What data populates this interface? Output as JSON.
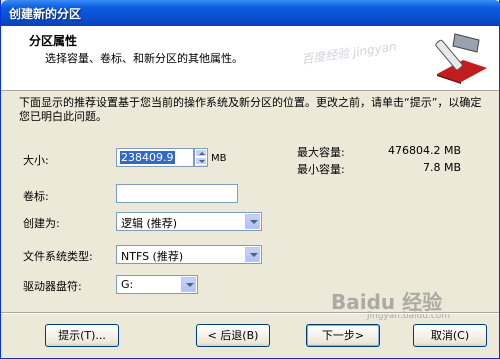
{
  "window": {
    "title": "创建新的分区"
  },
  "header": {
    "title": "分区属性",
    "subtitle": "选择容量、卷标、和新分区的其他属性。",
    "watermark": "百度经验 jingyan"
  },
  "description": "下面显示的推荐设置基于您当前的操作系统及新分区的位置。更改之前，请单击“提示”，以确定您已明白此问题。",
  "form": {
    "size_label": "大小:",
    "size_value": "238409.9",
    "size_unit": "MB",
    "max_label": "最大容量:",
    "max_value": "476804.2 MB",
    "min_label": "最小容量:",
    "min_value": "7.8 MB",
    "volume_label": "卷标:",
    "volume_value": "",
    "create_as_label": "创建为:",
    "create_as_value": "逻辑 (推荐)",
    "fs_label": "文件系统类型:",
    "fs_value": "NTFS (推荐)",
    "drive_label": "驱动器盘符:",
    "drive_value": "G:"
  },
  "buttons": {
    "hint": "提示(T)...",
    "back": "< 后退(B)",
    "next": "下一步>",
    "cancel": "取消(C)"
  },
  "watermark_bottom": "Baidu 经验",
  "watermark_url": "jingyan.baidu.com",
  "colors": {
    "titlebar": "#0a5ce0",
    "selection": "#316ac5",
    "face": "#ece9d8"
  }
}
